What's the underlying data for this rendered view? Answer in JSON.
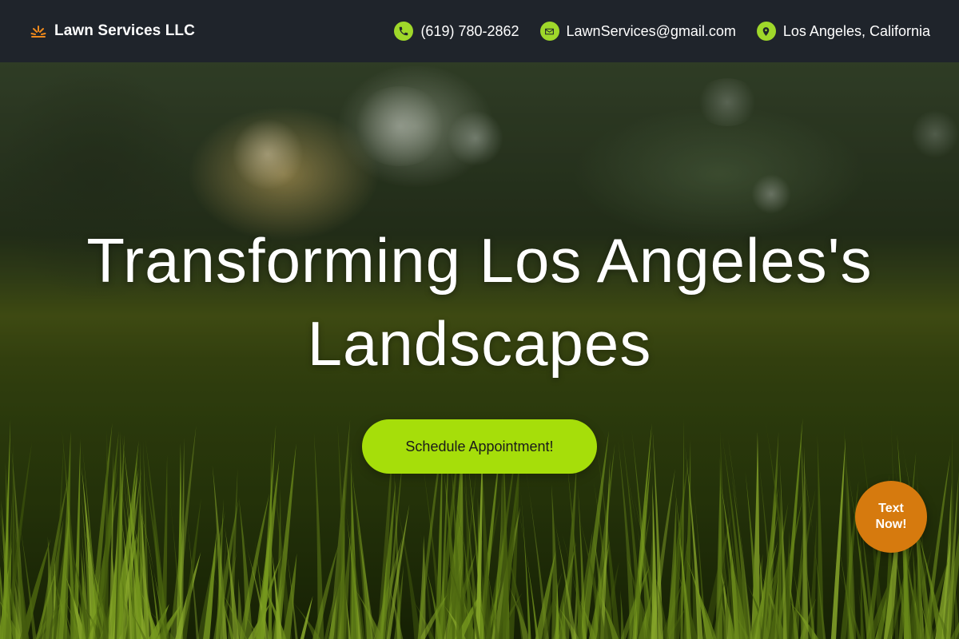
{
  "header": {
    "brand_name": "Lawn Services LLC",
    "phone": "(619) 780-2862",
    "email": "LawnServices@gmail.com",
    "location": "Los Angeles, California"
  },
  "hero": {
    "title": "Transforming Los Angeles's Landscapes",
    "cta_label": "Schedule Appointment!"
  },
  "floating": {
    "text_now_label": "Text Now!"
  },
  "icons": {
    "brand": "sun-logo-icon",
    "phone": "phone-icon",
    "email": "mail-icon",
    "location": "map-pin-icon"
  },
  "colors": {
    "header_bg": "#1f242b",
    "accent_green": "#a6de0a",
    "icon_green": "#9fd82a",
    "text_now_orange": "#d67a0e",
    "brand_logo_orange": "#f08a1c"
  }
}
